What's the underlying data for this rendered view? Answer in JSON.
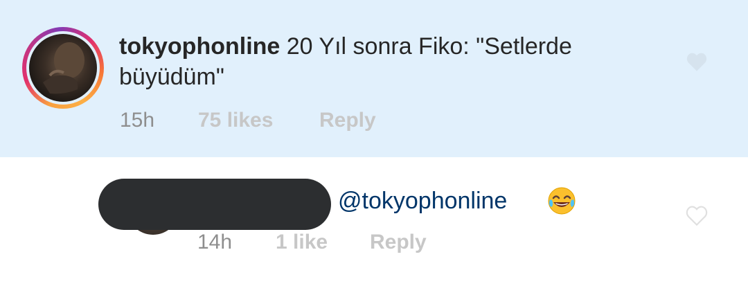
{
  "main_comment": {
    "username": "tokyophonline",
    "text": " 20 Yıl sonra Fiko: \"Setlerde büyüdüm\"",
    "time": "15h",
    "likes": "75 likes",
    "reply_label": "Reply",
    "highlighted": true
  },
  "reply_comment": {
    "username_redacted": true,
    "mention": "@tokyophonline",
    "emoji": "face-with-tears-of-joy",
    "time": "14h",
    "likes": "1 like",
    "reply_label": "Reply"
  },
  "colors": {
    "highlight_bg": "#e1f0fc",
    "mention": "#003569",
    "meta_text": "#8e8e8e",
    "meta_bold": "#c7c7c7"
  }
}
